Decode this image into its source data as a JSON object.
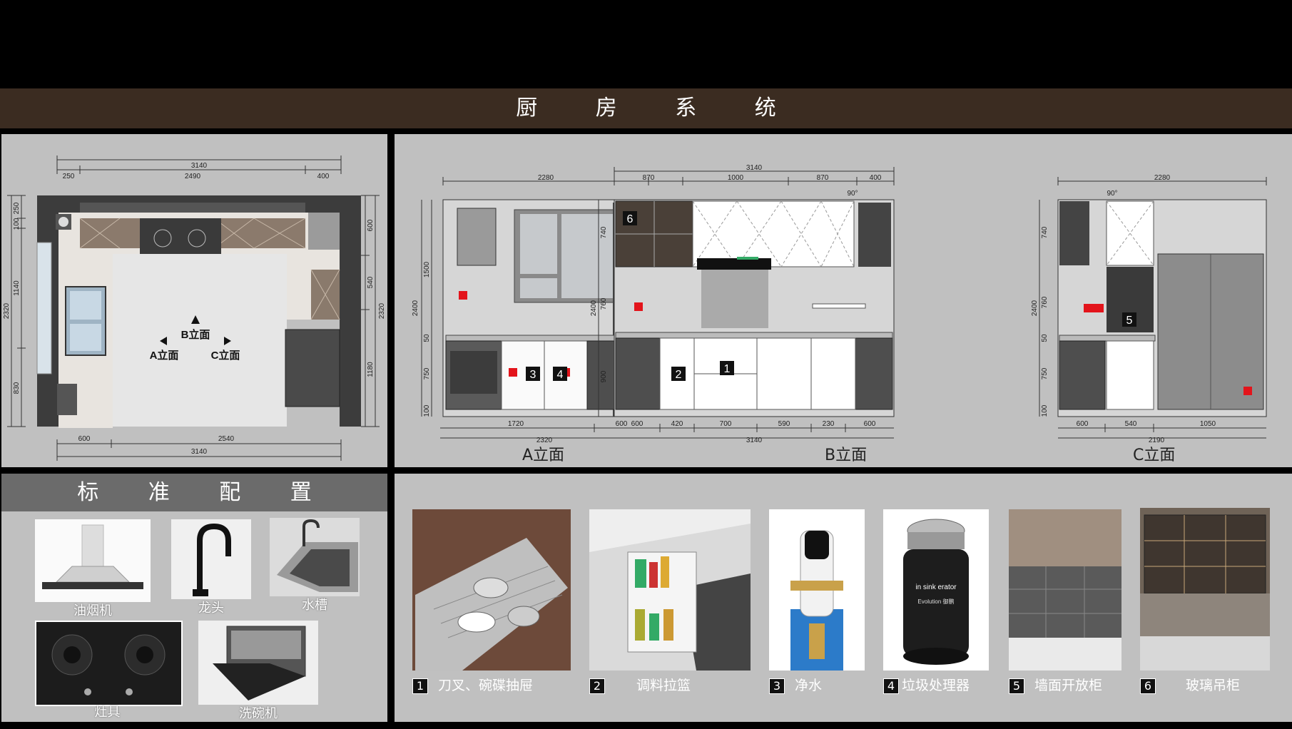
{
  "header": {
    "title": "厨 房 系 统"
  },
  "plan": {
    "dim_top_total": "3140",
    "dim_top_a": "250",
    "dim_top_b": "2490",
    "dim_top_c": "400",
    "dim_bottom_a": "600",
    "dim_bottom_b": "2540",
    "dim_bottom_total": "3140",
    "dim_left_a": "250",
    "dim_left_b": "100",
    "dim_left_c": "1140",
    "dim_left_d": "830",
    "dim_left_total": "2320",
    "dim_right_a": "600",
    "dim_right_b": "540",
    "dim_right_c": "1180",
    "dim_right_total": "2320",
    "label_a": "A立面",
    "label_b": "B立面",
    "label_c": "C立面"
  },
  "elevation_a": {
    "title": "A立面",
    "dim_top": "2280",
    "dim_bottom_a": "1720",
    "dim_bottom_b": "600",
    "dim_bottom_total": "2320",
    "dim_left_a": "1500",
    "dim_left_b": "50",
    "dim_left_c": "750",
    "dim_left_d": "100",
    "dim_left_total": "2400",
    "marker_3": "3",
    "marker_4": "4"
  },
  "elevation_b": {
    "title": "B立面",
    "dim_top_total": "3140",
    "dim_top_a": "870",
    "dim_top_b": "1000",
    "dim_top_c": "870",
    "dim_top_d": "400",
    "dim_bottom_a": "600",
    "dim_bottom_b": "420",
    "dim_bottom_c": "700",
    "dim_bottom_d": "590",
    "dim_bottom_e": "230",
    "dim_bottom_f": "600",
    "dim_bottom_total": "3140",
    "dim_left_a": "740",
    "dim_left_b": "760",
    "dim_left_c": "900",
    "dim_left_total": "2400",
    "angle": "90°",
    "marker_6": "6",
    "marker_2": "2",
    "marker_1": "1"
  },
  "elevation_c": {
    "title": "C立面",
    "dim_top": "2280",
    "dim_bottom_a": "600",
    "dim_bottom_b": "540",
    "dim_bottom_c": "1050",
    "dim_bottom_total": "2190",
    "dim_left_a": "740",
    "dim_left_b": "760",
    "dim_left_c": "50",
    "dim_left_d": "750",
    "dim_left_e": "100",
    "dim_left_total": "2400",
    "angle": "90°",
    "marker_5": "5"
  },
  "standard": {
    "title": "标 准 配 置",
    "items": [
      {
        "label": "油烟机"
      },
      {
        "label": "龙头"
      },
      {
        "label": "水槽"
      },
      {
        "label": "灶具"
      },
      {
        "label": "洗碗机"
      }
    ]
  },
  "features": [
    {
      "num": "1",
      "label": "刀叉、碗碟抽屉"
    },
    {
      "num": "2",
      "label": "调料拉篮"
    },
    {
      "num": "3",
      "label": "净水"
    },
    {
      "num": "4",
      "label": "垃圾处理器"
    },
    {
      "num": "5",
      "label": "墙面开放柜"
    },
    {
      "num": "6",
      "label": "玻璃吊柜"
    }
  ],
  "photo_text": {
    "disposer_brand": "in sink erator",
    "disposer_model": "Evolution 御鹏"
  },
  "colors": {
    "header_band": "#3b2c21",
    "panel": "#c0c0c0",
    "std_header": "#6b6b6b",
    "marker_red": "#e3141b"
  }
}
